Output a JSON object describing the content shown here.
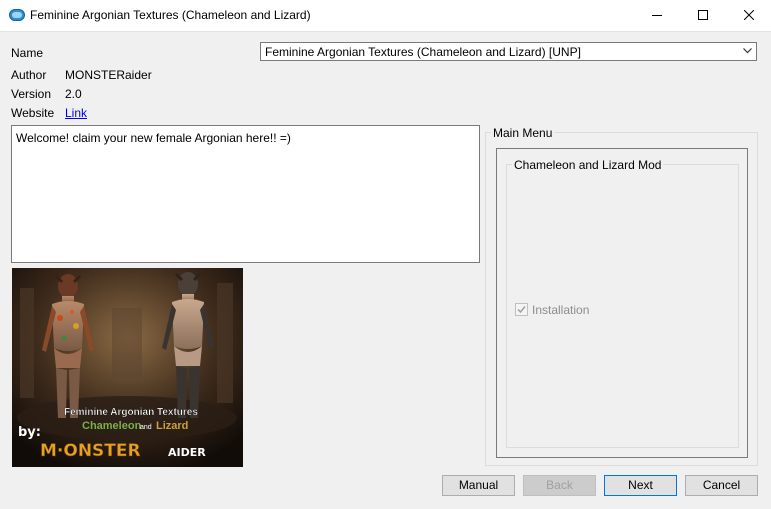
{
  "window": {
    "title": "Feminine Argonian Textures (Chameleon and Lizard)"
  },
  "fields": {
    "name_label": "Name",
    "name_value": "Feminine Argonian Textures (Chameleon and Lizard) [UNP]",
    "author_label": "Author",
    "author_value": "MONSTERaider",
    "version_label": "Version",
    "version_value": "2.0",
    "website_label": "Website",
    "website_link": "Link"
  },
  "description": "Welcome! claim your new female Argonian here!! =)",
  "preview": {
    "caption_line1": "Feminine Argonian Textures",
    "caption_word1": "Chameleon",
    "caption_and": "and",
    "caption_word2": "Lizard",
    "by": "by:",
    "brand": "M·ONSTER",
    "brand_suffix": "AIDER"
  },
  "menu": {
    "group_title": "Main Menu",
    "sub_group_title": "Chameleon and Lizard Mod",
    "option_label": "Installation",
    "option_checked": true,
    "option_enabled": false
  },
  "buttons": {
    "manual": "Manual",
    "back": "Back",
    "next": "Next",
    "cancel": "Cancel"
  },
  "colors": {
    "window_bg": "#f0f0f0",
    "link": "#0000ee",
    "default_button_border": "#0078d7",
    "app_icon": "#2b8fd9"
  },
  "icons": {
    "app": "fomod-installer-icon",
    "minimize": "minimize-icon",
    "maximize": "maximize-icon",
    "close": "close-icon",
    "dropdown": "chevron-down-icon",
    "checkmark": "checkmark-icon"
  }
}
